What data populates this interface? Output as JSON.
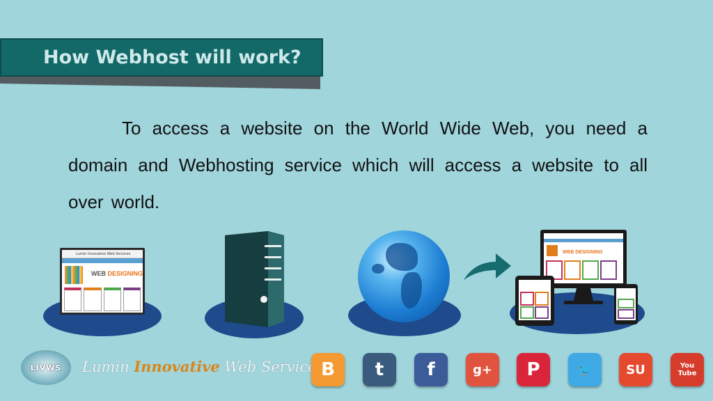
{
  "slide": {
    "title": "How Webhost will work?",
    "body": "To access a website on the World Wide Web, you need a domain and Webhosting service which will access a website to all over world."
  },
  "illustration": {
    "website_header": "Lumin Innovative Web Services",
    "website_banner_prefix": "WEB ",
    "website_banner_highlight": "DESIGNING"
  },
  "footer": {
    "logo_text": "LIVWS",
    "brand_part1": "Lumin ",
    "brand_part2": "Innovative",
    "brand_part3": " Web Services",
    "social": [
      {
        "name": "blogger",
        "glyph": "B",
        "color": "#f39a33"
      },
      {
        "name": "tumblr",
        "glyph": "t",
        "color": "#3b5b7e"
      },
      {
        "name": "facebook",
        "glyph": "f",
        "color": "#3c5b99"
      },
      {
        "name": "google-plus",
        "glyph": "g+",
        "color": "#e0533f"
      },
      {
        "name": "pinterest",
        "glyph": "P",
        "color": "#d9243a"
      },
      {
        "name": "twitter",
        "glyph": "🐦",
        "color": "#3fa9e6"
      },
      {
        "name": "stumbleupon",
        "glyph": "SU",
        "color": "#e64a2e"
      },
      {
        "name": "youtube",
        "glyph": "You Tube",
        "color": "#d63c2b"
      }
    ]
  },
  "colors": {
    "background": "#a0d5dc",
    "title_bar": "#136868",
    "disc": "#1f4a8c",
    "arrow": "#166b6f"
  }
}
